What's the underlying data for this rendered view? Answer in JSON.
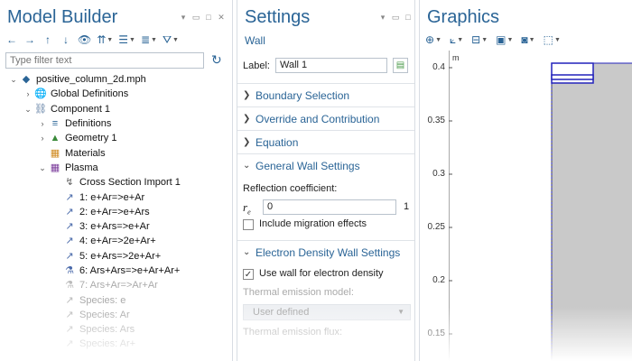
{
  "model_builder": {
    "title": "Model Builder",
    "filter_placeholder": "Type filter text",
    "tree": [
      {
        "label": "positive_column_2d.mph",
        "level": 0,
        "twisty": "open",
        "icon": "model-file-icon"
      },
      {
        "label": "Global Definitions",
        "level": 1,
        "twisty": "closed",
        "icon": "globe-icon"
      },
      {
        "label": "Component 1",
        "level": 1,
        "twisty": "open",
        "icon": "component-icon"
      },
      {
        "label": "Definitions",
        "level": 2,
        "twisty": "closed",
        "icon": "definitions-icon"
      },
      {
        "label": "Geometry 1",
        "level": 2,
        "twisty": "closed",
        "icon": "geometry-icon"
      },
      {
        "label": "Materials",
        "level": 2,
        "twisty": "none",
        "icon": "materials-icon"
      },
      {
        "label": "Plasma",
        "level": 2,
        "twisty": "open",
        "icon": "plasma-icon"
      },
      {
        "label": "Cross Section Import 1",
        "level": 3,
        "twisty": "none",
        "icon": "cross-section-icon"
      },
      {
        "label": "1: e+Ar=>e+Ar",
        "level": 3,
        "twisty": "none",
        "icon": "reaction-icon"
      },
      {
        "label": "2: e+Ar=>e+Ars",
        "level": 3,
        "twisty": "none",
        "icon": "reaction-icon"
      },
      {
        "label": "3: e+Ars=>e+Ar",
        "level": 3,
        "twisty": "none",
        "icon": "reaction-icon"
      },
      {
        "label": "4: e+Ar=>2e+Ar+",
        "level": 3,
        "twisty": "none",
        "icon": "reaction-icon"
      },
      {
        "label": "5: e+Ars=>2e+Ar+",
        "level": 3,
        "twisty": "none",
        "icon": "reaction-icon"
      },
      {
        "label": "6: Ars+Ars=>e+Ar+Ar+",
        "level": 3,
        "twisty": "none",
        "icon": "reaction-flask-icon"
      },
      {
        "label": "7: Ars+Ar=>Ar+Ar",
        "level": 3,
        "twisty": "none",
        "icon": "reaction-flask-icon",
        "dim": true
      },
      {
        "label": "Species: e",
        "level": 3,
        "twisty": "none",
        "icon": "species-icon",
        "dim": true
      },
      {
        "label": "Species: Ar",
        "level": 3,
        "twisty": "none",
        "icon": "species-icon",
        "dim": true
      },
      {
        "label": "Species: Ars",
        "level": 3,
        "twisty": "none",
        "icon": "species-icon",
        "dim": true
      },
      {
        "label": "Species: Ar+",
        "level": 3,
        "twisty": "none",
        "icon": "species-icon",
        "dim": true
      }
    ]
  },
  "settings": {
    "title": "Settings",
    "subtitle": "Wall",
    "label_caption": "Label:",
    "label_value": "Wall 1",
    "sections": {
      "boundary": "Boundary Selection",
      "override": "Override and Contribution",
      "equation": "Equation",
      "general": "General Wall Settings",
      "electron": "Electron Density Wall Settings"
    },
    "reflection_caption": "Reflection coefficient:",
    "reflection_symbol": "r",
    "reflection_subscript": "e",
    "reflection_value": "0",
    "reflection_unit": "1",
    "migration_label": "Include migration effects",
    "migration_checked": false,
    "use_wall_label": "Use wall for electron density",
    "use_wall_checked": true,
    "thermal_model_caption": "Thermal emission model:",
    "thermal_model_value": "User defined",
    "thermal_flux_caption": "Thermal emission flux:"
  },
  "graphics": {
    "title": "Graphics",
    "axis_unit": "m",
    "y_ticks": [
      "0.4",
      "0.35",
      "0.3",
      "0.25",
      "0.2",
      "0.15"
    ]
  },
  "colors": {
    "accent": "#2a6496",
    "geometry_fill": "#c9c9c9",
    "selection_blue": "#2222bb"
  }
}
